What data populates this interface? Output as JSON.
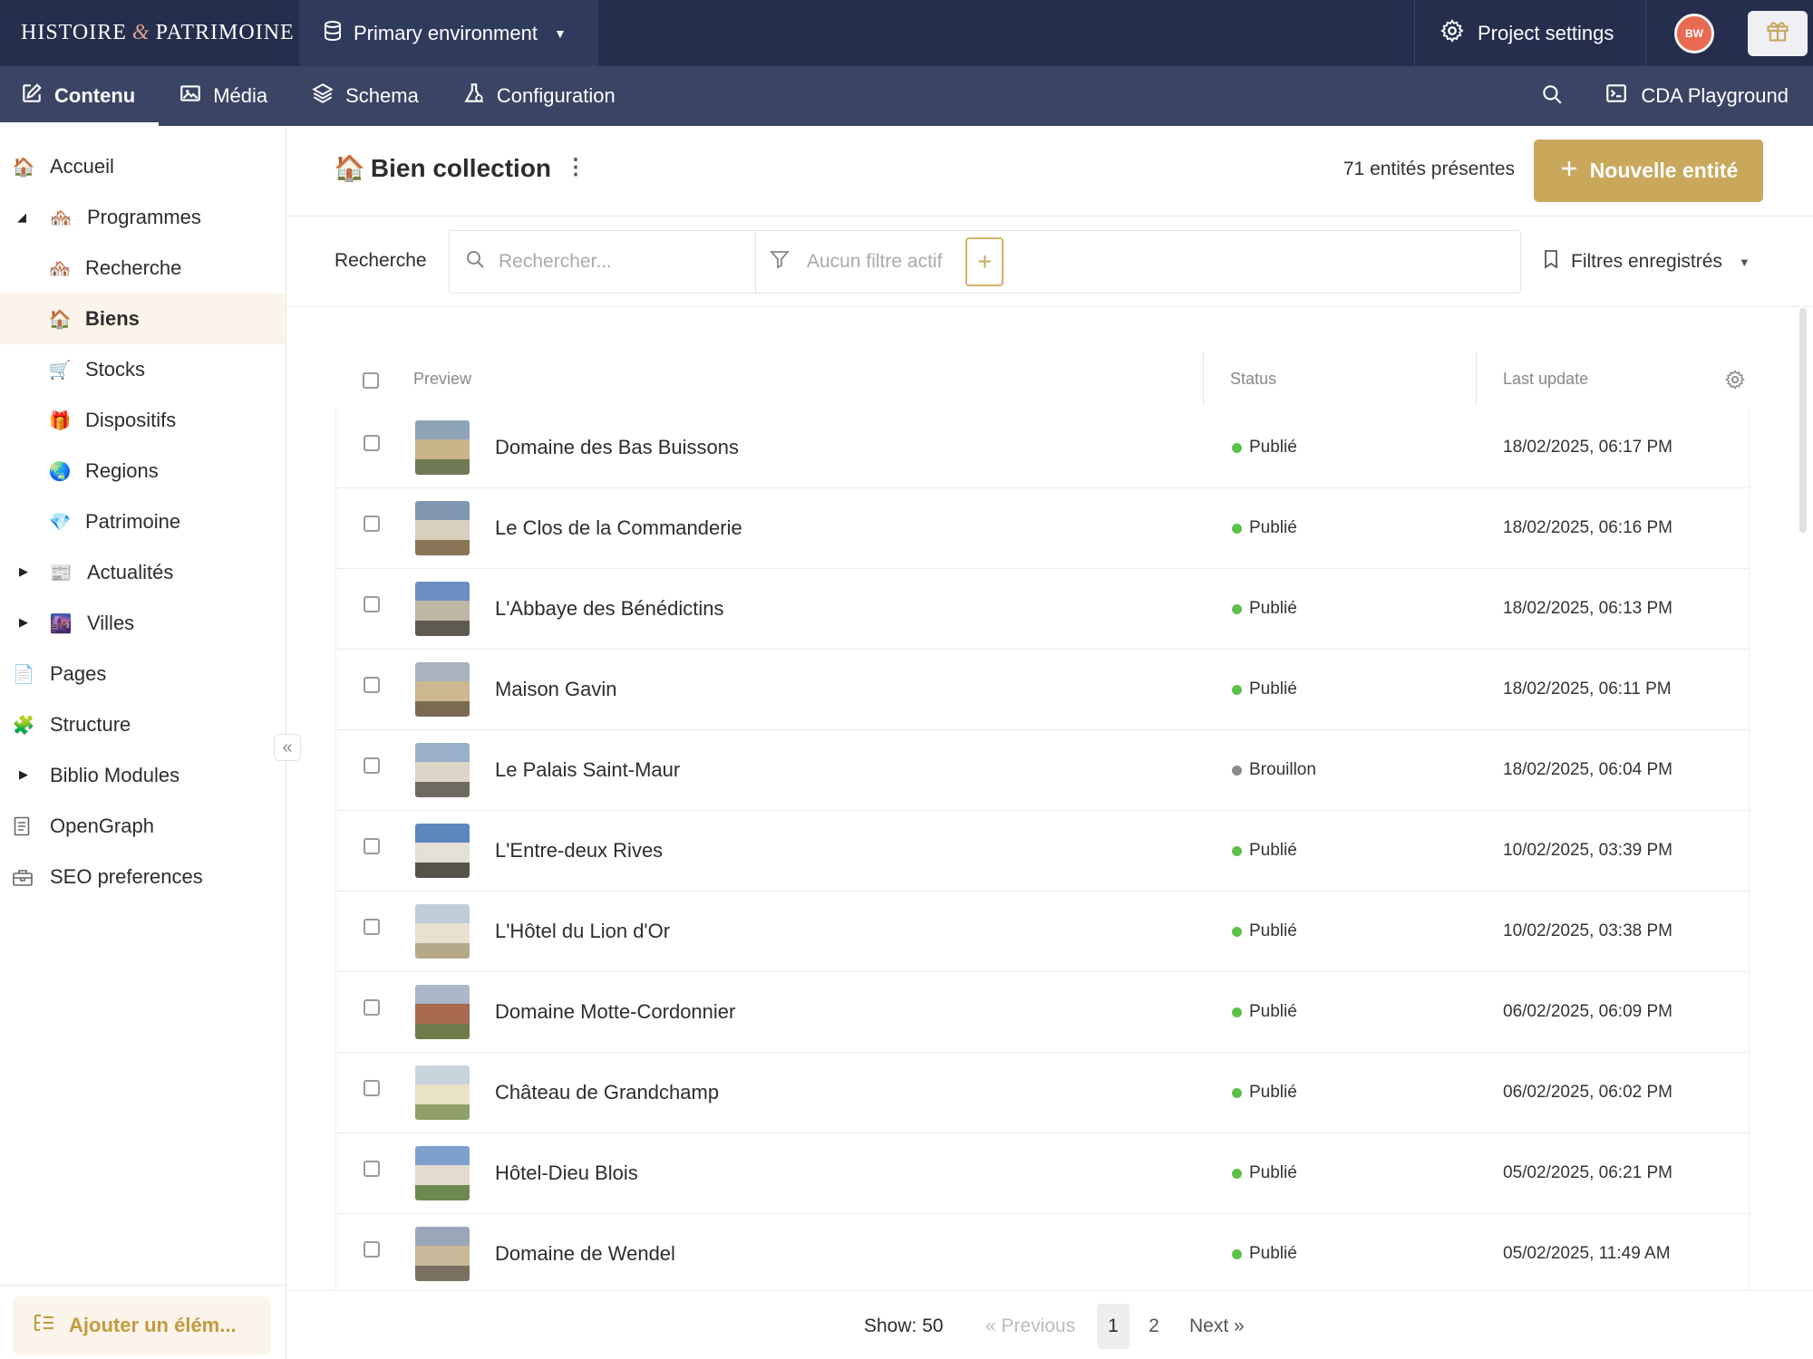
{
  "topbar": {
    "brand_left": "HISTOIRE",
    "brand_amp": "&",
    "brand_right": "PATRIMOINE",
    "environment": "Primary environment",
    "project_settings": "Project settings",
    "avatar_initials": "BW"
  },
  "navbar": {
    "tabs": [
      {
        "label": "Contenu",
        "icon": "edit-icon"
      },
      {
        "label": "Média",
        "icon": "image-icon"
      },
      {
        "label": "Schema",
        "icon": "layers-icon"
      },
      {
        "label": "Configuration",
        "icon": "flask-icon"
      }
    ],
    "cda": "CDA Playground"
  },
  "sidebar": {
    "items": [
      {
        "label": "Accueil",
        "emoji": "🏠"
      },
      {
        "label": "Programmes",
        "emoji": "🏘️"
      },
      {
        "label": "Recherche",
        "emoji": "🏘️"
      },
      {
        "label": "Biens",
        "emoji": "🏠"
      },
      {
        "label": "Stocks",
        "emoji": "🛒"
      },
      {
        "label": "Dispositifs",
        "emoji": "🎁"
      },
      {
        "label": "Regions",
        "emoji": "🌏"
      },
      {
        "label": "Patrimoine",
        "emoji": "💎"
      },
      {
        "label": "Actualités",
        "emoji": "📰"
      },
      {
        "label": "Villes",
        "emoji": "🌆"
      },
      {
        "label": "Pages",
        "emoji": "📄"
      },
      {
        "label": "Structure",
        "emoji": "🧩"
      },
      {
        "label": "Biblio Modules",
        "emoji": ""
      },
      {
        "label": "OpenGraph",
        "emoji": ""
      },
      {
        "label": "SEO preferences",
        "emoji": ""
      }
    ],
    "add_button": "Ajouter un élém..."
  },
  "header": {
    "emoji": "🏠",
    "title": "Bien collection",
    "count": "71 entités présentes",
    "new_button": "Nouvelle entité"
  },
  "search": {
    "label": "Recherche",
    "placeholder": "Rechercher...",
    "filter_placeholder": "Aucun filtre actif",
    "saved_filters": "Filtres enregistrés"
  },
  "table": {
    "columns": [
      "Preview",
      "Status",
      "Last update"
    ],
    "rows": [
      {
        "title": "Domaine des Bas Buissons",
        "status": "Publié",
        "date": "18/02/2025, 06:17 PM"
      },
      {
        "title": "Le Clos de la Commanderie",
        "status": "Publié",
        "date": "18/02/2025, 06:16 PM"
      },
      {
        "title": "L'Abbaye des Bénédictins",
        "status": "Publié",
        "date": "18/02/2025, 06:13 PM"
      },
      {
        "title": "Maison Gavin",
        "status": "Publié",
        "date": "18/02/2025, 06:11 PM"
      },
      {
        "title": "Le Palais Saint-Maur",
        "status": "Brouillon",
        "date": "18/02/2025, 06:04 PM"
      },
      {
        "title": "L'Entre-deux Rives",
        "status": "Publié",
        "date": "10/02/2025, 03:39 PM"
      },
      {
        "title": "L'Hôtel du Lion d'Or",
        "status": "Publié",
        "date": "10/02/2025, 03:38 PM"
      },
      {
        "title": "Domaine Motte-Cordonnier",
        "status": "Publié",
        "date": "06/02/2025, 06:09 PM"
      },
      {
        "title": "Château de Grandchamp",
        "status": "Publié",
        "date": "06/02/2025, 06:02 PM"
      },
      {
        "title": "Hôtel-Dieu Blois",
        "status": "Publié",
        "date": "05/02/2025, 06:21 PM"
      },
      {
        "title": "Domaine de Wendel",
        "status": "Publié",
        "date": "05/02/2025, 11:49 AM"
      }
    ]
  },
  "pagination": {
    "show": "Show: 50",
    "previous": "« Previous",
    "pages": [
      "1",
      "2"
    ],
    "next": "Next »"
  },
  "colors": {
    "topbar": "#252e4d",
    "navbar": "#3a4565",
    "accent": "#c9a85c",
    "published": "#5cc04a",
    "draft": "#8a8a8a"
  }
}
